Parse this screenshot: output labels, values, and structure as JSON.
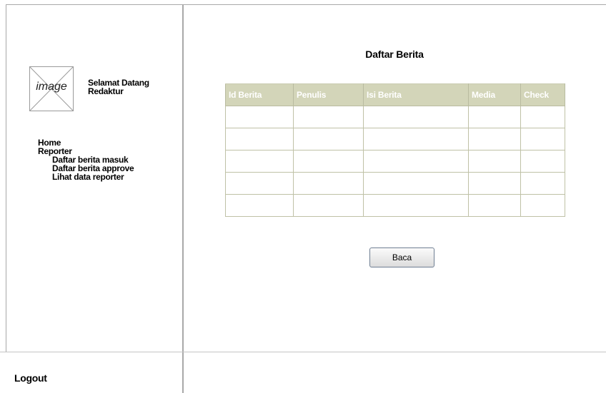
{
  "sidebar": {
    "image_placeholder_label": "image",
    "welcome_line1": "Selamat Datang",
    "welcome_line2": "Redaktur",
    "nav": {
      "home": "Home",
      "reporter": "Reporter",
      "sub_items": [
        "Daftar berita masuk",
        "Daftar berita approve",
        "Lihat data reporter"
      ]
    },
    "logout": "Logout"
  },
  "main": {
    "title": "Daftar Berita",
    "table": {
      "columns": [
        "Id Berita",
        "Penulis",
        "Isi Berita",
        "Media",
        "Check"
      ],
      "rows": [
        [
          "",
          "",
          "",
          "",
          ""
        ],
        [
          "",
          "",
          "",
          "",
          ""
        ],
        [
          "",
          "",
          "",
          "",
          ""
        ],
        [
          "",
          "",
          "",
          "",
          ""
        ],
        [
          "",
          "",
          "",
          "",
          ""
        ]
      ]
    },
    "read_button_label": "Baca"
  },
  "colors": {
    "table_header_bg": "#d3d5b9",
    "table_header_text": "#ffffff",
    "frame_line": "#a8a8a8"
  }
}
